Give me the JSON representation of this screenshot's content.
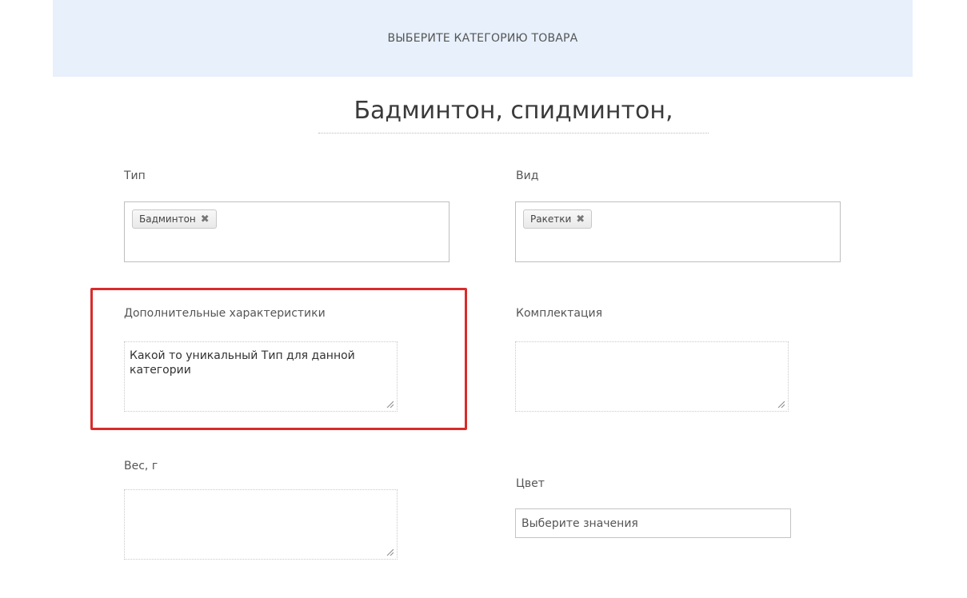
{
  "header": {
    "category_label": "ВЫБЕРИТЕ КАТЕГОРИЮ ТОВАРА"
  },
  "product": {
    "title": "Бадминтон, спидминтон,"
  },
  "fields": {
    "type": {
      "label": "Тип",
      "tags": [
        "Бадминтон"
      ]
    },
    "kind": {
      "label": "Вид",
      "tags": [
        "Ракетки"
      ]
    },
    "extra": {
      "label": "Дополнительные характеристики",
      "value": "Какой то уникальный Тип для данной категории"
    },
    "set": {
      "label": "Комплектация",
      "value": ""
    },
    "weight": {
      "label": "Вес, г",
      "value": ""
    },
    "color": {
      "label": "Цвет",
      "placeholder": "Выберите значения"
    }
  },
  "ui": {
    "tag_remove_glyph": "✖",
    "highlight_color": "#d92b2b",
    "header_bg": "#e7f0fb"
  }
}
